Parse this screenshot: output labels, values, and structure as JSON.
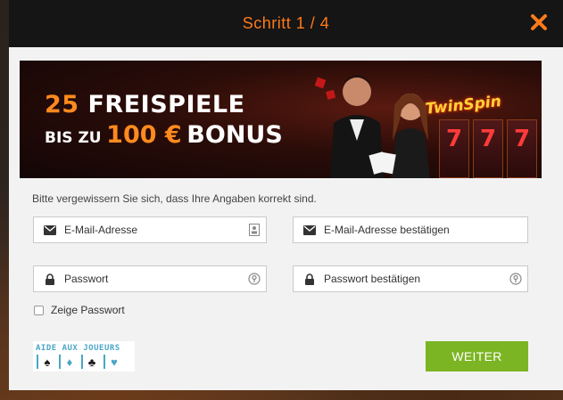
{
  "header": {
    "title": "Schritt 1 / 4"
  },
  "banner": {
    "line1_highlight": "25",
    "line1_text": "FREISPIELE",
    "line2_prefix": "BIS ZU",
    "line2_amount": "100 €",
    "line2_suffix": "BONUS",
    "slot_logo": "TwinSpin",
    "reels": [
      "7",
      "7",
      "7"
    ]
  },
  "form": {
    "info": "Bitte vergewissern Sie sich, dass Ihre Angaben korrekt sind.",
    "email": {
      "placeholder": "E-Mail-Adresse",
      "value": ""
    },
    "email_confirm": {
      "placeholder": "E-Mail-Adresse bestätigen",
      "value": ""
    },
    "password": {
      "placeholder": "Passwort",
      "value": ""
    },
    "password_confirm": {
      "placeholder": "Passwort bestätigen",
      "value": ""
    },
    "show_password_label": "Zeige Passwort",
    "show_password_checked": false
  },
  "footer": {
    "aide_text": "AIDE AUX JOUEURS",
    "suits": [
      "♠",
      "♦",
      "♣",
      "♥"
    ],
    "continue_label": "WEITER"
  },
  "colors": {
    "accent_orange": "#ff7a1a",
    "button_green": "#7cb524",
    "header_bg": "#151515"
  },
  "icons": {
    "close": "close-icon",
    "email": "envelope-icon",
    "lock": "lock-icon",
    "card": "contact-card-icon",
    "password_visibility": "password-key-icon"
  }
}
